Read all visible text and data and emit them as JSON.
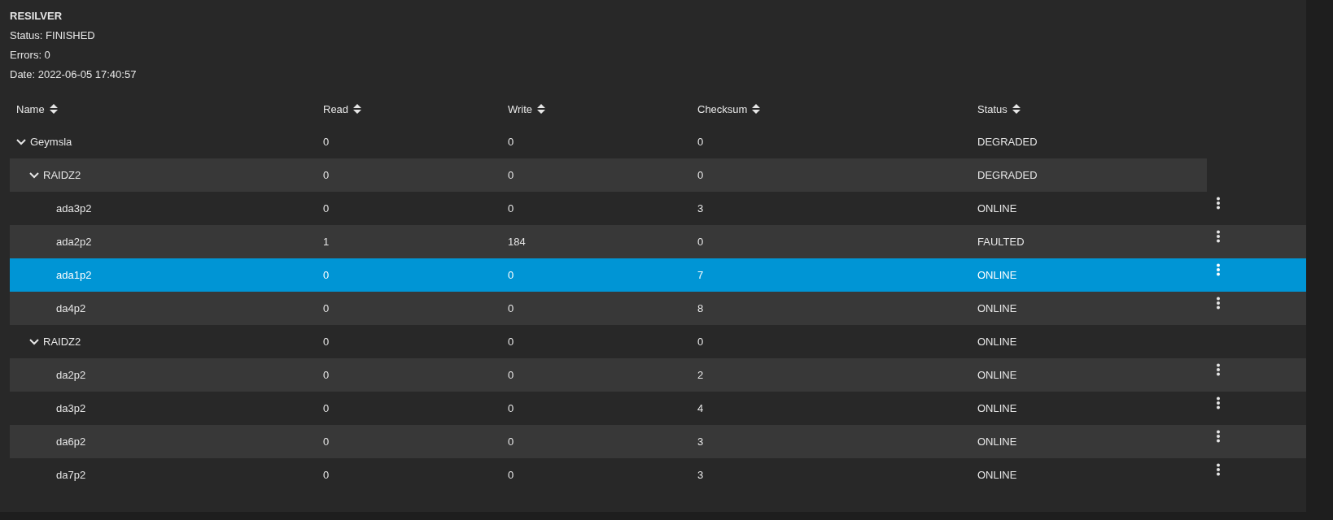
{
  "summary": {
    "title": "RESILVER",
    "lines": [
      "Status: FINISHED",
      "Errors: 0",
      "Date: 2022-06-05 17:40:57"
    ]
  },
  "table": {
    "columns": [
      "Name",
      "Read",
      "Write",
      "Checksum",
      "Status"
    ],
    "rows": [
      {
        "name": "Geymsla",
        "read": "0",
        "write": "0",
        "checksum": "0",
        "status": "DEGRADED",
        "selected": false,
        "expanded": true,
        "children": [
          {
            "name": "RAIDZ2",
            "read": "0",
            "write": "0",
            "checksum": "0",
            "status": "DEGRADED",
            "selected": false,
            "expanded": true,
            "children": [
              {
                "name": "ada3p2",
                "read": "0",
                "write": "0",
                "checksum": "3",
                "status": "ONLINE",
                "selected": false
              },
              {
                "name": "ada2p2",
                "read": "1",
                "write": "184",
                "checksum": "0",
                "status": "FAULTED",
                "selected": false
              },
              {
                "name": "ada1p2",
                "read": "0",
                "write": "0",
                "checksum": "7",
                "status": "ONLINE",
                "selected": true
              },
              {
                "name": "da4p2",
                "read": "0",
                "write": "0",
                "checksum": "8",
                "status": "ONLINE",
                "selected": false
              }
            ]
          },
          {
            "name": "RAIDZ2",
            "read": "0",
            "write": "0",
            "checksum": "0",
            "status": "ONLINE",
            "selected": false,
            "expanded": true,
            "children": [
              {
                "name": "da2p2",
                "read": "0",
                "write": "0",
                "checksum": "2",
                "status": "ONLINE",
                "selected": false
              },
              {
                "name": "da3p2",
                "read": "0",
                "write": "0",
                "checksum": "4",
                "status": "ONLINE",
                "selected": false
              },
              {
                "name": "da6p2",
                "read": "0",
                "write": "0",
                "checksum": "3",
                "status": "ONLINE",
                "selected": false
              },
              {
                "name": "da7p2",
                "read": "0",
                "write": "0",
                "checksum": "3",
                "status": "ONLINE",
                "selected": false
              }
            ]
          }
        ]
      }
    ]
  }
}
